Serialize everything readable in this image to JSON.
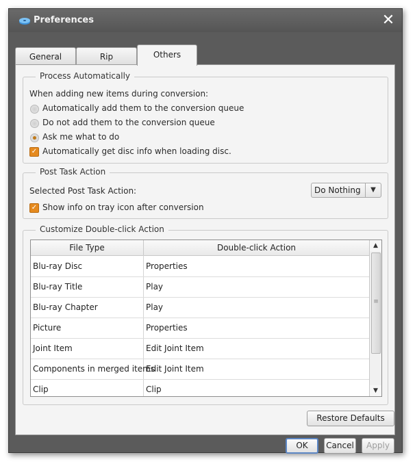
{
  "window": {
    "title": "Preferences"
  },
  "tabs": [
    {
      "label": "General"
    },
    {
      "label": "Rip"
    },
    {
      "label": "Others"
    }
  ],
  "process_group": {
    "legend": "Process Automatically",
    "intro": "When adding new items during conversion:",
    "options": [
      {
        "label": "Automatically add them to the conversion queue",
        "selected": false
      },
      {
        "label": "Do not add them to the conversion queue",
        "selected": false
      },
      {
        "label": "Ask me what to do",
        "selected": true
      }
    ],
    "disc_info_checkbox": {
      "label": "Automatically get disc info when loading disc.",
      "checked": true
    }
  },
  "post_task_group": {
    "legend": "Post Task Action",
    "selected_label": "Selected Post Task Action:",
    "selected_value": "Do Nothing",
    "tray_checkbox": {
      "label": "Show info on tray icon after conversion",
      "checked": true
    }
  },
  "double_click_group": {
    "legend": "Customize Double-click Action",
    "columns": [
      "File Type",
      "Double-click Action"
    ],
    "rows": [
      [
        "Blu-ray Disc",
        "Properties"
      ],
      [
        "Blu-ray Title",
        "Play"
      ],
      [
        "Blu-ray Chapter",
        "Play"
      ],
      [
        "Picture",
        "Properties"
      ],
      [
        "Joint Item",
        "Edit Joint Item"
      ],
      [
        "Components in merged items",
        "Edit Joint Item"
      ],
      [
        "Clip",
        "Clip"
      ]
    ]
  },
  "buttons": {
    "restore_defaults": "Restore Defaults",
    "ok": "OK",
    "cancel": "Cancel",
    "apply": "Apply"
  },
  "colors": {
    "accent": "#e58a1f",
    "titlebar": "#5b5b5b",
    "focus": "#5b86c4"
  }
}
